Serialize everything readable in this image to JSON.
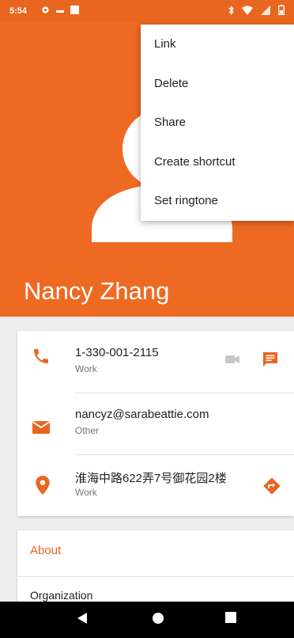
{
  "status_bar": {
    "time": "5:54"
  },
  "contact": {
    "name": "Nancy Zhang"
  },
  "menu": {
    "items": [
      {
        "label": "Link"
      },
      {
        "label": "Delete"
      },
      {
        "label": "Share"
      },
      {
        "label": "Create shortcut"
      },
      {
        "label": "Set ringtone"
      }
    ]
  },
  "details": {
    "phone": {
      "value": "1-330-001-2115",
      "type": "Work"
    },
    "email": {
      "value": "nancyz@sarabeattie.com",
      "type": "Other"
    },
    "address": {
      "value": "淮海中路622弄7号御花园2楼",
      "type": "Work"
    }
  },
  "about": {
    "title": "About",
    "organization_label": "Organization"
  },
  "colors": {
    "accent": "#e8661f",
    "header": "#ee6a22"
  },
  "icons": [
    "gear-icon",
    "bluetooth-icon",
    "wifi-icon",
    "signal-icon",
    "battery-icon",
    "phone-icon",
    "video-call-icon",
    "message-icon",
    "email-icon",
    "location-icon",
    "directions-icon",
    "back-icon",
    "home-icon",
    "recents-icon"
  ]
}
